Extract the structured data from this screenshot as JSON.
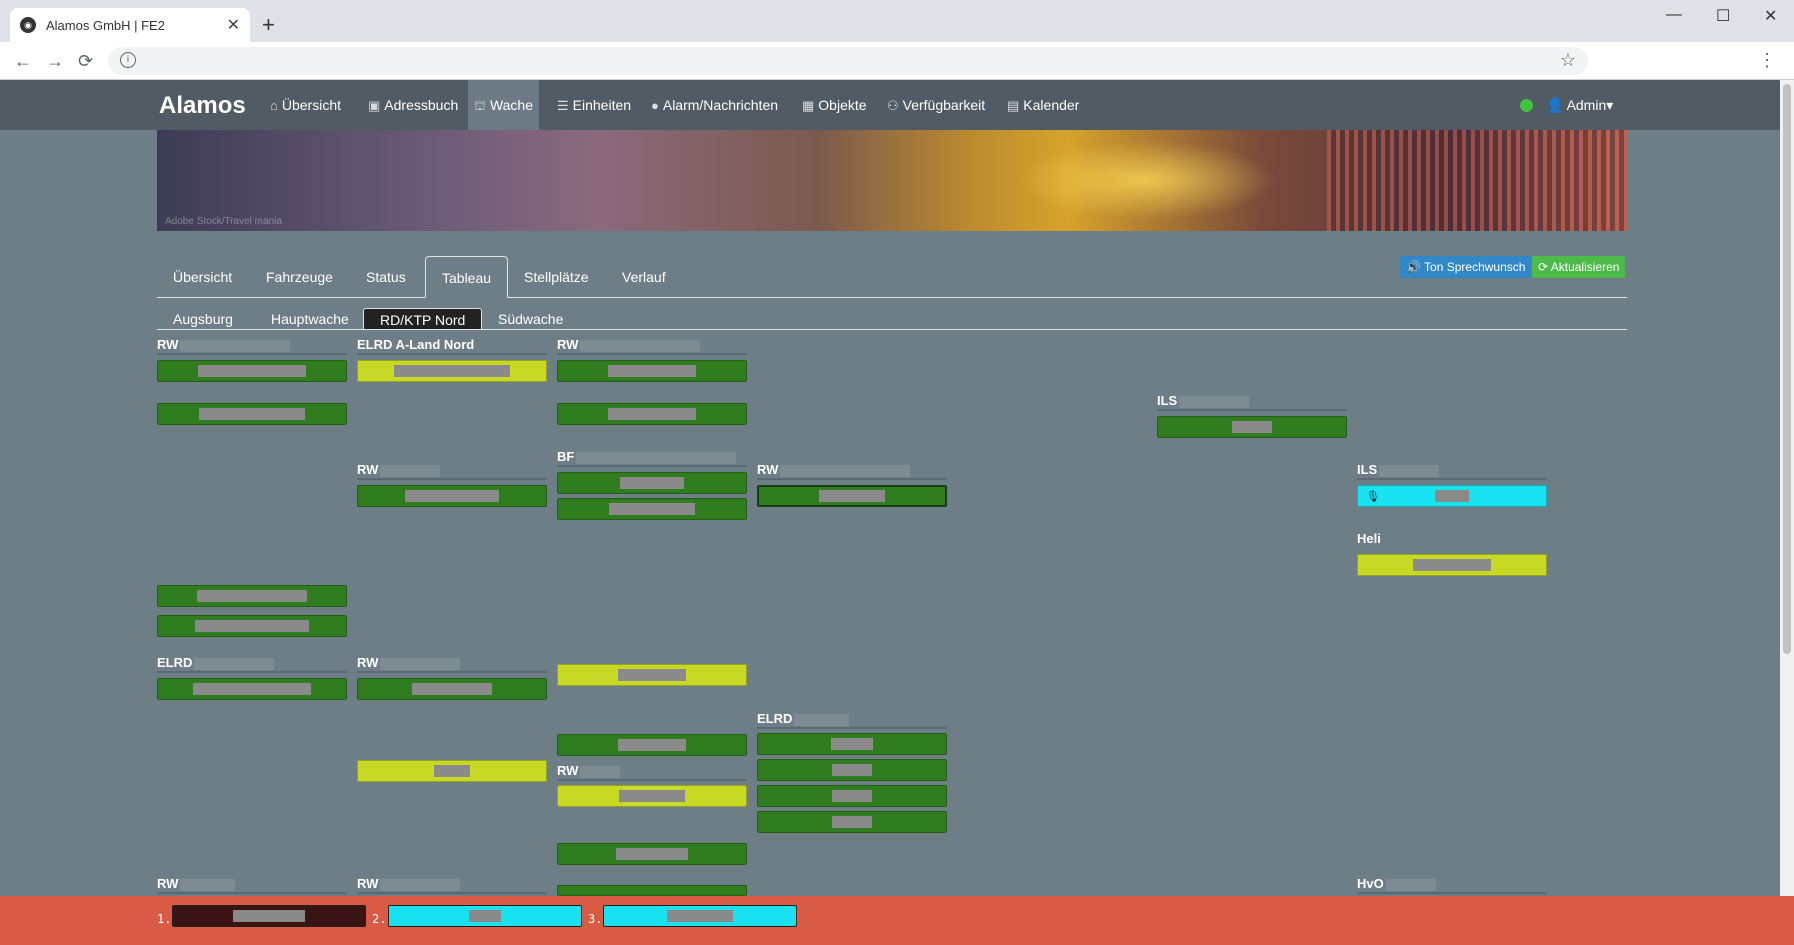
{
  "browser": {
    "tab_title": "Alamos GmbH | FE2",
    "new_tab_label": "+",
    "minimize": "—",
    "maximize": "☐",
    "close": "✕",
    "back": "←",
    "forward": "→",
    "reload": "⟳",
    "bookmark_icon": "☆",
    "menu_icon": "⋮"
  },
  "navbar": {
    "brand": "Alamos",
    "items": [
      {
        "label": "Übersicht",
        "icon": "⌂"
      },
      {
        "label": "Adressbuch",
        "icon": "▣"
      },
      {
        "label": "Wache",
        "icon": "⛫"
      },
      {
        "label": "Einheiten",
        "icon": "☰"
      },
      {
        "label": "Alarm/Nachrichten",
        "icon": "●"
      },
      {
        "label": "Objekte",
        "icon": "▦"
      },
      {
        "label": "Verfügbarkeit",
        "icon": "⚇"
      },
      {
        "label": "Kalender",
        "icon": "▤"
      }
    ],
    "user": "Admin",
    "status_color": "#45c140"
  },
  "banner": {
    "credit": "Adobe Stock/Travel mania"
  },
  "tabs": {
    "main": [
      "Übersicht",
      "Fahrzeuge",
      "Status",
      "Tableau",
      "Stellplätze",
      "Verlauf"
    ],
    "active_main": "Tableau",
    "sub": [
      "Augsburg",
      "Hauptwache",
      "RD/KTP Nord",
      "Südwache"
    ],
    "active_sub": "RD/KTP Nord"
  },
  "actions": {
    "sprechwunsch": "🔊 Ton Sprechwunsch",
    "aktualisieren": "⟳ Aktualisieren"
  },
  "headers": {
    "h1": "RW",
    "h2": "ELRD A-Land Nord",
    "h3": "RW",
    "h4": "ILS",
    "h5": "RW",
    "h6": "BF",
    "h7": "RW",
    "h8": "ILS",
    "h9": "Heli",
    "h10": "ELRD",
    "h11": "RW",
    "h12": "ELRD",
    "h13": "RW",
    "h14": "RW",
    "h15": "RW",
    "h16": "HvO"
  },
  "queue": [
    "1.",
    "2.",
    "3."
  ],
  "colors": {
    "green": "#2f7d1f",
    "yellow": "#c8d925",
    "cyan": "#18e2f0",
    "footer": "#d95b46",
    "dark_red": "#3a1414"
  }
}
